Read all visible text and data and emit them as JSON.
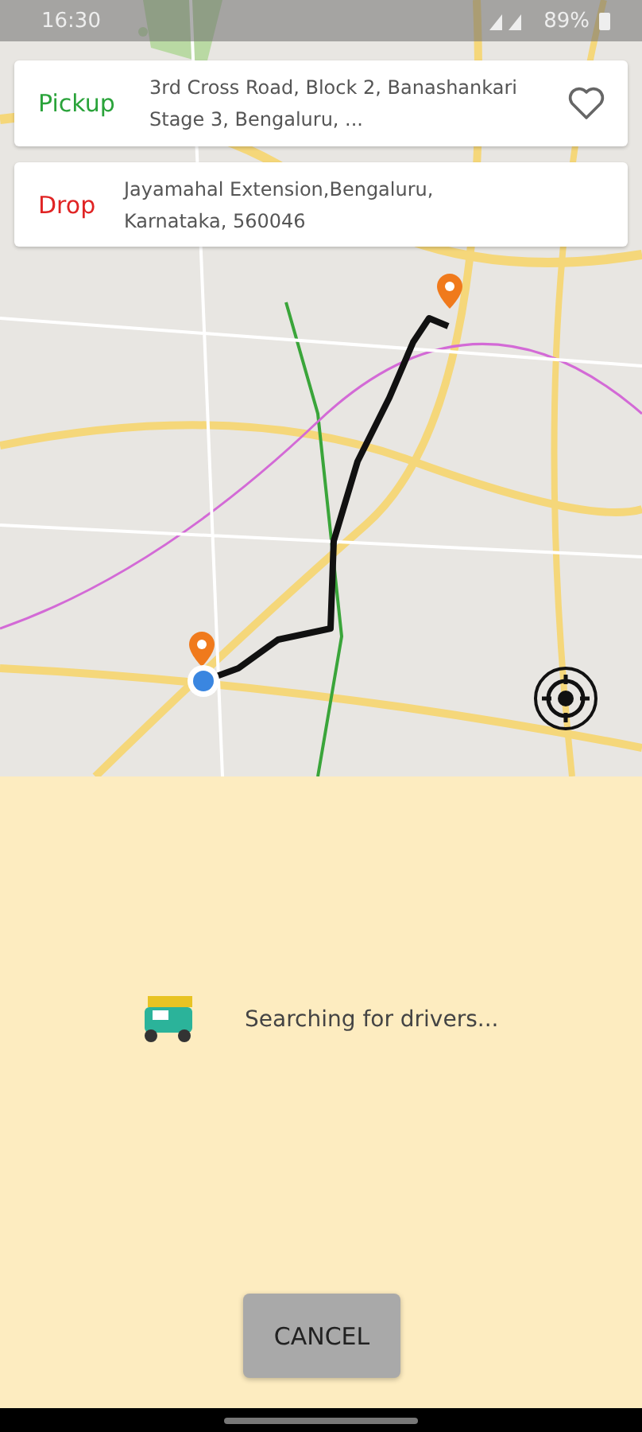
{
  "status_bar": {
    "time": "16:30",
    "battery": "89%"
  },
  "pickup": {
    "label": "Pickup",
    "address": "3rd Cross Road, Block 2, Banashankari Stage 3, Bengaluru, ..."
  },
  "drop": {
    "label": "Drop",
    "address": "Jayamahal Extension,Bengaluru, Karnataka, 560046"
  },
  "status": {
    "message": "Searching for drivers..."
  },
  "buttons": [
    "CANCEL"
  ]
}
